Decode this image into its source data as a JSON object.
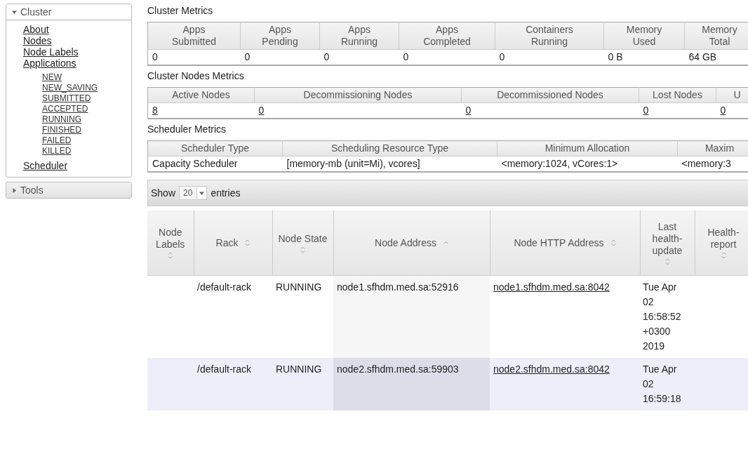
{
  "sidebar": {
    "sections": [
      {
        "title": "Cluster",
        "expanded": true,
        "items": [
          {
            "label": "About"
          },
          {
            "label": "Nodes"
          },
          {
            "label": "Node Labels"
          },
          {
            "label": "Applications",
            "children": [
              {
                "label": "NEW"
              },
              {
                "label": "NEW_SAVING"
              },
              {
                "label": "SUBMITTED"
              },
              {
                "label": "ACCEPTED"
              },
              {
                "label": "RUNNING"
              },
              {
                "label": "FINISHED"
              },
              {
                "label": "FAILED"
              },
              {
                "label": "KILLED"
              }
            ]
          },
          {
            "label": "Scheduler"
          }
        ]
      },
      {
        "title": "Tools",
        "expanded": false
      }
    ]
  },
  "metrics": [
    {
      "title": "Cluster Metrics",
      "columns": [
        "Apps Submitted",
        "Apps Pending",
        "Apps Running",
        "Apps Completed",
        "Containers Running",
        "Memory Used",
        "Memory Total"
      ],
      "row": [
        {
          "text": "0",
          "link": false
        },
        {
          "text": "0",
          "link": false
        },
        {
          "text": "0",
          "link": false
        },
        {
          "text": "0",
          "link": false
        },
        {
          "text": "0",
          "link": false
        },
        {
          "text": "0 B",
          "link": false
        },
        {
          "text": "64 GB",
          "link": false
        }
      ]
    },
    {
      "title": "Cluster Nodes Metrics",
      "columns": [
        "Active Nodes",
        "Decommissioning Nodes",
        "Decommissioned Nodes",
        "Lost Nodes",
        "U"
      ],
      "row": [
        {
          "text": "8",
          "link": true
        },
        {
          "text": "0",
          "link": true
        },
        {
          "text": "0",
          "link": true
        },
        {
          "text": "0",
          "link": true
        },
        {
          "text": "0",
          "link": true
        }
      ]
    },
    {
      "title": "Scheduler Metrics",
      "columns": [
        "Scheduler Type",
        "Scheduling Resource Type",
        "Minimum Allocation",
        "Maxim"
      ],
      "row": [
        {
          "text": "Capacity Scheduler",
          "link": false
        },
        {
          "text": "[memory-mb (unit=Mi), vcores]",
          "link": false
        },
        {
          "text": "<memory:1024, vCores:1>",
          "link": false
        },
        {
          "text": "<memory:3",
          "link": false
        }
      ]
    }
  ],
  "nodes_table": {
    "length_control": {
      "show_label": "Show",
      "page_size": "20",
      "entries_label": "entries"
    },
    "columns": [
      {
        "label": "Node Labels",
        "sorted": false
      },
      {
        "label": "Rack",
        "sorted": false
      },
      {
        "label": "Node State",
        "sorted": false
      },
      {
        "label": "Node Address",
        "sorted": true
      },
      {
        "label": "Node HTTP Address",
        "sorted": false
      },
      {
        "label": "Last health-update",
        "sorted": false
      },
      {
        "label": "Health-report",
        "sorted": false
      }
    ],
    "rows": [
      {
        "rack": "/default-rack",
        "state": "RUNNING",
        "address": "node1.sfhdm.med.sa:52916",
        "http_address": "node1.sfhdm.med.sa:8042",
        "last_health_update": "Tue Apr 02 16:58:52 +0300 2019"
      },
      {
        "rack": "/default-rack",
        "state": "RUNNING",
        "address": "node2.sfhdm.med.sa:59903",
        "http_address": "node2.sfhdm.med.sa:8042",
        "last_health_update": "Tue Apr 02 16:59:18"
      }
    ]
  }
}
